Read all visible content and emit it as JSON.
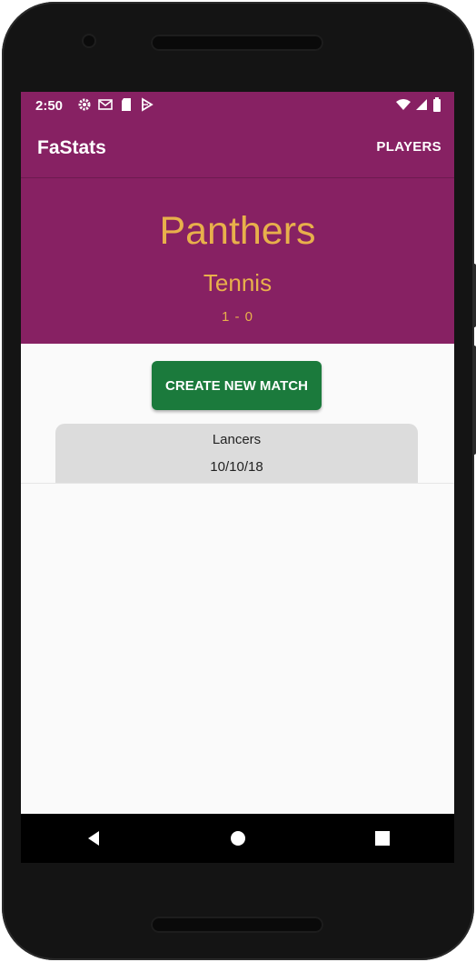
{
  "status_bar": {
    "time": "2:50",
    "left_icons": [
      "settings-icon",
      "gmail-icon",
      "sd-card-icon",
      "play-store-icon"
    ],
    "right_icons": [
      "wifi-icon",
      "signal-icon",
      "battery-icon"
    ]
  },
  "app_bar": {
    "title": "FaStats",
    "players_label": "PLAYERS"
  },
  "team": {
    "name": "Panthers",
    "sport": "Tennis",
    "record": "1 - 0"
  },
  "create_match_label": "CREATE NEW MATCH",
  "matches": [
    {
      "opponent": "Lancers",
      "date": "10/10/18"
    }
  ],
  "nav": {
    "icons": [
      "back-icon",
      "home-icon",
      "recents-icon"
    ]
  },
  "colors": {
    "primary": "#872163",
    "accent_text": "#e8b04b",
    "button": "#1b7a3c",
    "card": "#dcdcdc"
  }
}
